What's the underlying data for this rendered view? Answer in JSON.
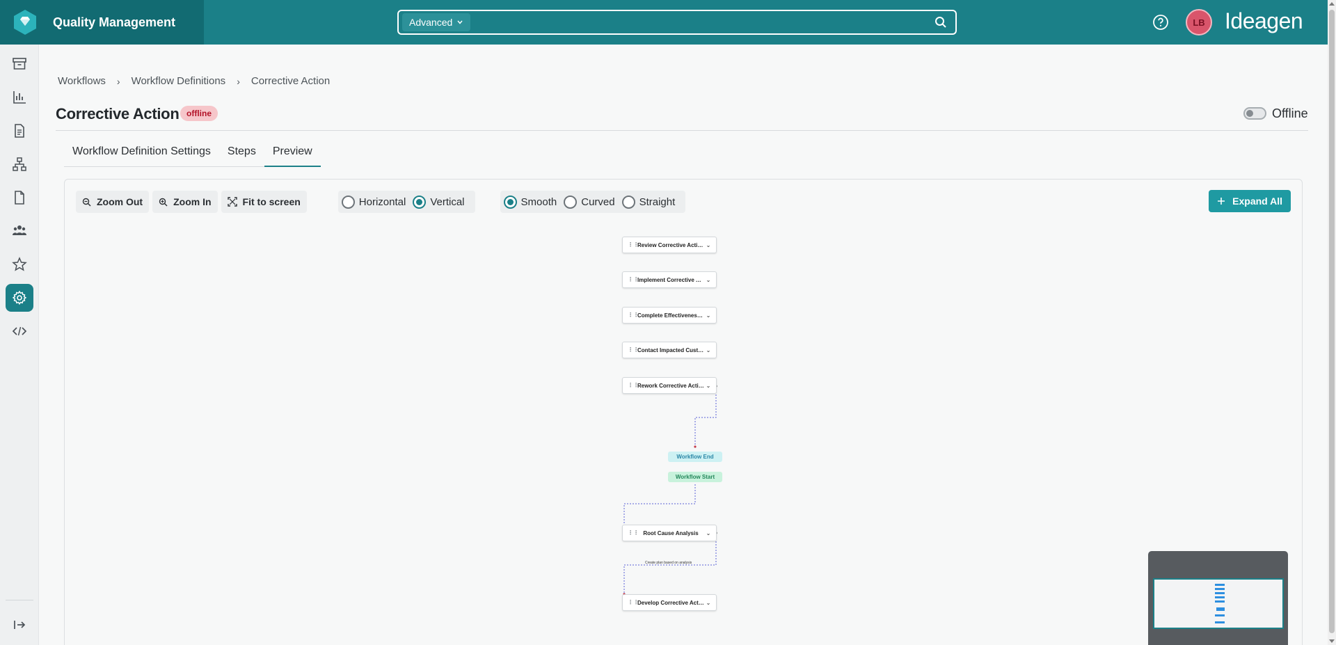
{
  "app": {
    "title": "Quality Management",
    "brand_color": "#1b8088",
    "vendor": "Ideagen"
  },
  "search": {
    "mode_label": "Advanced",
    "placeholder": "",
    "value": ""
  },
  "user": {
    "initials": "LB"
  },
  "sidebar": {
    "items": [
      {
        "name": "archive-icon"
      },
      {
        "name": "chart-icon"
      },
      {
        "name": "document-list-icon"
      },
      {
        "name": "hierarchy-icon"
      },
      {
        "name": "file-icon"
      },
      {
        "name": "people-icon"
      },
      {
        "name": "star-icon"
      },
      {
        "name": "gear-icon",
        "active": true
      },
      {
        "name": "code-icon"
      }
    ],
    "collapse_icon": "expand-sidebar-icon"
  },
  "breadcrumb": [
    "Workflows",
    "Workflow Definitions",
    "Corrective Action"
  ],
  "page": {
    "title": "Corrective Action",
    "status_badge": "offline",
    "toggle_label": "Offline",
    "toggle_on": false
  },
  "tabs": [
    {
      "label": "Workflow Definition Settings",
      "active": false
    },
    {
      "label": "Steps",
      "active": false
    },
    {
      "label": "Preview",
      "active": true
    }
  ],
  "toolbar": {
    "zoom_out": "Zoom Out",
    "zoom_in": "Zoom In",
    "fit": "Fit to screen",
    "orientation": [
      {
        "label": "Horizontal",
        "checked": false
      },
      {
        "label": "Vertical",
        "checked": true
      }
    ],
    "edge_style": [
      {
        "label": "Smooth",
        "checked": true
      },
      {
        "label": "Curved",
        "checked": false
      },
      {
        "label": "Straight",
        "checked": false
      }
    ],
    "expand_all": "Expand All"
  },
  "flow": {
    "nodes": [
      "Review Corrective Actio...",
      "Implement Corrective Ac...",
      "Complete Effectiveness ...",
      "Contact Impacted Custo...",
      "Rework Corrective Action",
      "Root Cause Analysis",
      "Develop Corrective Acti..."
    ],
    "end_label": "Workflow End",
    "start_label": "Workflow Start",
    "edge_label": "Create plan based on analysis"
  }
}
